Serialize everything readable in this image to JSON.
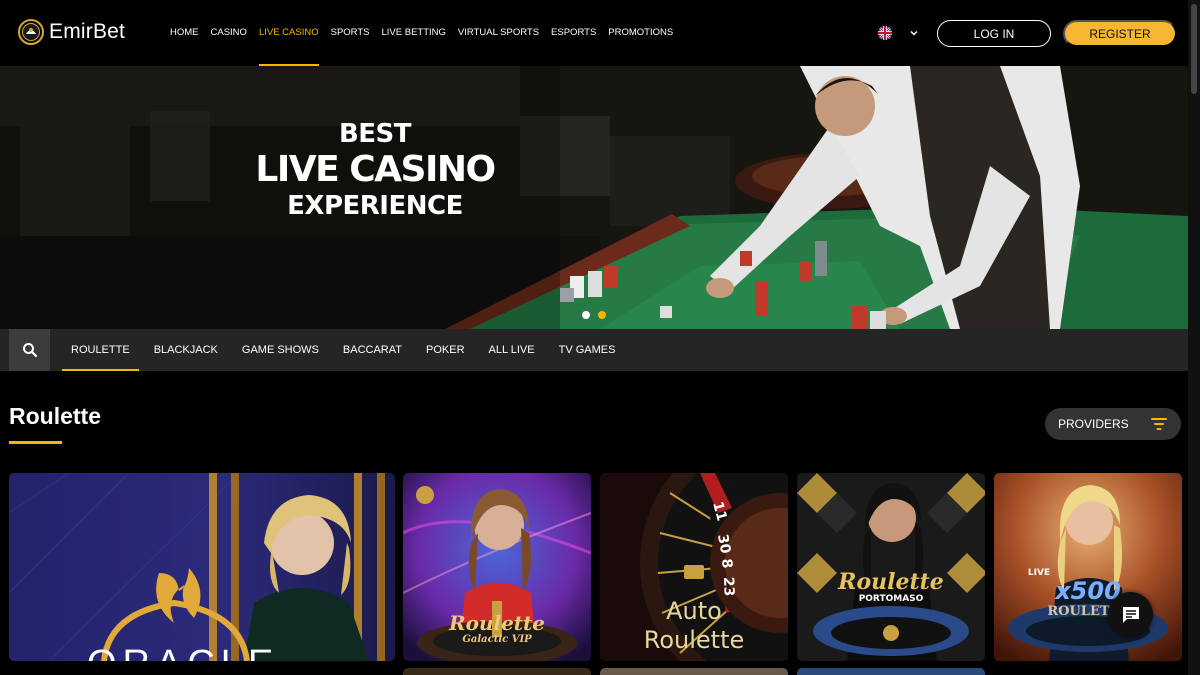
{
  "brand": {
    "name": "EmirBet"
  },
  "nav": {
    "items": [
      {
        "label": "HOME",
        "active": false
      },
      {
        "label": "CASINO",
        "active": false
      },
      {
        "label": "LIVE CASINO",
        "active": true
      },
      {
        "label": "SPORTS",
        "active": false
      },
      {
        "label": "LIVE BETTING",
        "active": false
      },
      {
        "label": "VIRTUAL SPORTS",
        "active": false
      },
      {
        "label": "ESPORTS",
        "active": false
      },
      {
        "label": "PROMOTIONS",
        "active": false
      }
    ],
    "language_icon": "uk-flag-icon",
    "login_label": "LOG IN",
    "register_label": "REGISTER"
  },
  "hero": {
    "line1": "BEST",
    "line2": "LIVE CASINO",
    "line3": "EXPERIENCE",
    "slides": 2,
    "active_slide": 2
  },
  "categories": {
    "search_icon": "search-icon",
    "items": [
      {
        "label": "ROULETTE",
        "active": true
      },
      {
        "label": "BLACKJACK",
        "active": false
      },
      {
        "label": "GAME SHOWS",
        "active": false
      },
      {
        "label": "BACCARAT",
        "active": false
      },
      {
        "label": "POKER",
        "active": false
      },
      {
        "label": "ALL LIVE",
        "active": false
      },
      {
        "label": "TV GAMES",
        "active": false
      }
    ]
  },
  "section": {
    "title": "Roulette",
    "providers_label": "PROVIDERS"
  },
  "games": {
    "tile1": {
      "text": "ORACLE"
    },
    "tile2": {
      "line1": "Roulette",
      "line2": "Galactic VIP"
    },
    "tile3": {
      "line1": "Auto",
      "line2": "Roulette",
      "wheel_numbers": [
        "11",
        "30",
        "8",
        "23"
      ]
    },
    "tile4": {
      "line1": "Roulette",
      "line2": "PORTOMASO"
    },
    "tile5": {
      "line1": "LIVE",
      "line2": "x500",
      "line3": "ROULETTE"
    }
  },
  "colors": {
    "accent": "#f5b800",
    "register_bg": "#f5b632",
    "catbar_bg": "#252525",
    "felt_green": "#1d6b3a"
  }
}
